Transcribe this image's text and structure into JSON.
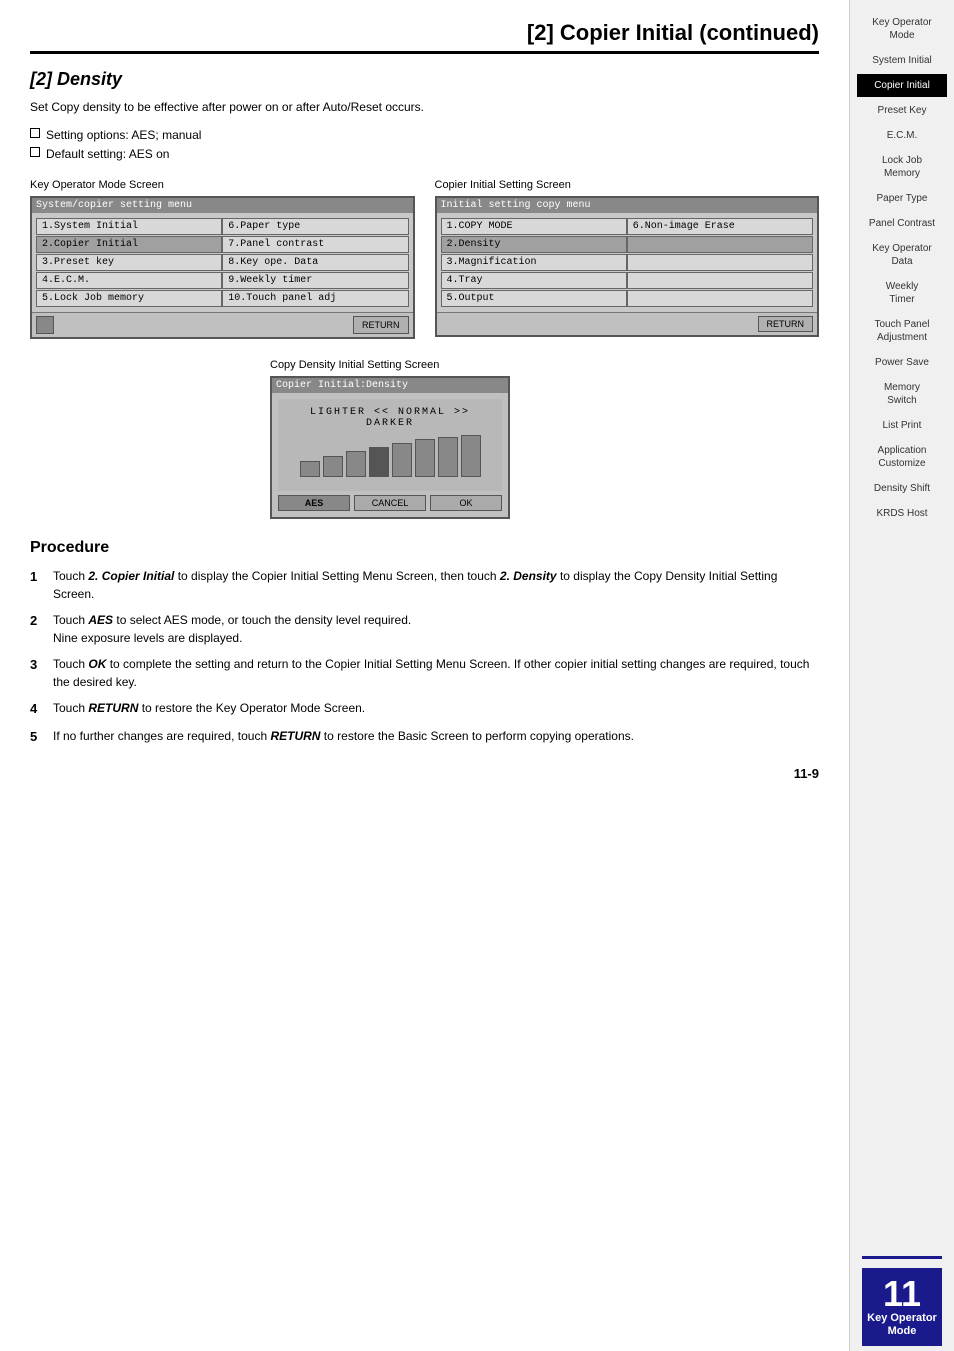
{
  "header": {
    "title": "[2] Copier Initial (continued)"
  },
  "section": {
    "title": "[2] Density",
    "description": "Set Copy density to be effective after power on or after Auto/Reset occurs.",
    "options": [
      "Setting options: AES; manual",
      "Default setting: AES on"
    ]
  },
  "key_operator_screen": {
    "label": "Key Operator Mode Screen",
    "title": "System/copier setting menu",
    "rows": [
      [
        "1.System Initial",
        "6.Paper type"
      ],
      [
        "2.Copier Initial",
        "7.Panel contrast"
      ],
      [
        "3.Preset key",
        "8.Key ope. Data"
      ],
      [
        "4.E.C.M.",
        "9.Weekly timer"
      ],
      [
        "5.Lock Job memory",
        "10.Touch panel adj"
      ]
    ],
    "footer": "RETURN"
  },
  "copier_initial_screen": {
    "label": "Copier Initial Setting Screen",
    "title": "Initial setting copy menu",
    "rows": [
      [
        "1.COPY MODE",
        "6.Non-image Erase"
      ],
      [
        "2.Density",
        ""
      ],
      [
        "3.Magnification",
        ""
      ],
      [
        "4.Tray",
        ""
      ],
      [
        "5.Output",
        ""
      ]
    ],
    "footer": "RETURN"
  },
  "density_screen": {
    "label": "Copy Density Initial Setting Screen",
    "title": "Copier Initial:Density",
    "scale_label": "LIGHTER << NORMAL >> DARKER",
    "bars": [
      8,
      14,
      18,
      24,
      28,
      32,
      36,
      38
    ],
    "buttons": [
      "AES",
      "CANCEL",
      "OK"
    ]
  },
  "procedure": {
    "title": "Procedure",
    "steps": [
      {
        "number": "1",
        "text": "Touch ",
        "bold1": "2. Copier Initial",
        "text2": " to display the Copier Initial Setting Menu Screen, then touch ",
        "bold2": "2. Density",
        "text3": " to display the Copy Density Initial Setting Screen."
      },
      {
        "number": "2",
        "text": "Touch ",
        "bold1": "AES",
        "text2": " to select AES mode, or touch the density level required.",
        "text3": "Nine exposure levels are displayed."
      },
      {
        "number": "3",
        "text": "Touch ",
        "bold1": "OK",
        "text2": " to complete the setting and return to the Copier Initial Setting Menu Screen. If other copier initial setting changes are required, touch the desired key."
      },
      {
        "number": "4",
        "text": "Touch ",
        "bold1": "RETURN",
        "text2": " to restore the Key Operator Mode Screen."
      },
      {
        "number": "5",
        "text": "If no further changes are required, touch ",
        "bold1": "RETURN",
        "text2": " to restore the Basic Screen to perform copying operations."
      }
    ]
  },
  "sidebar": {
    "items": [
      {
        "label": "Key Operator\nMode",
        "active": false
      },
      {
        "label": "System Initial",
        "active": false
      },
      {
        "label": "Copier Initial",
        "active": true
      },
      {
        "label": "Preset Key",
        "active": false
      },
      {
        "label": "E.C.M.",
        "active": false
      },
      {
        "label": "Lock Job\nMemory",
        "active": false
      },
      {
        "label": "Paper Type",
        "active": false
      },
      {
        "label": "Panel Contrast",
        "active": false
      },
      {
        "label": "Key Operator\nData",
        "active": false
      },
      {
        "label": "Weekly\nTimer",
        "active": false
      },
      {
        "label": "Touch Panel\nAdjustment",
        "active": false
      },
      {
        "label": "Power Save",
        "active": false
      },
      {
        "label": "Memory\nSwitch",
        "active": false
      },
      {
        "label": "List Print",
        "active": false
      },
      {
        "label": "Application\nCustomize",
        "active": false
      },
      {
        "label": "Density Shift",
        "active": false
      },
      {
        "label": "KRDS Host",
        "active": false
      }
    ],
    "badge_label": "Key Operator\nMode",
    "chapter_number": "11",
    "page_number": "11-9"
  }
}
